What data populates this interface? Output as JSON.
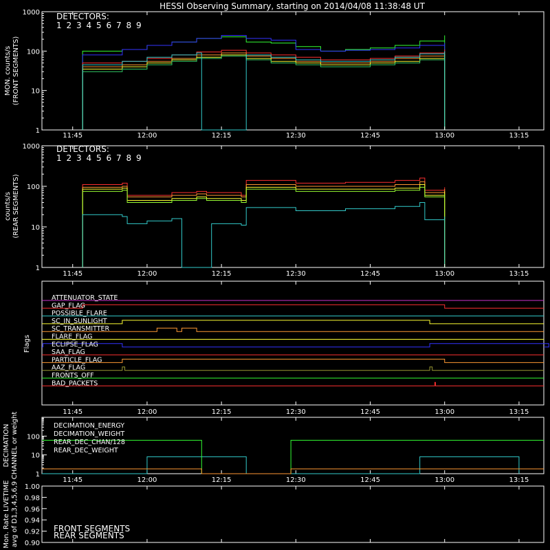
{
  "title": "HESSI Observing Summary, starting on 2014/04/08 11:38:48 UT",
  "x_ticks": [
    "11:45",
    "12:00",
    "12:15",
    "12:30",
    "12:45",
    "13:00",
    "13:15"
  ],
  "colors": {
    "d1": "#ff3030",
    "d2": "#ff3030",
    "d3": "#ff9933",
    "d4": "#ffff33",
    "d5": "#99ff33",
    "d6": "#33ff33",
    "d7": "#33cc66",
    "d8": "#33cccc",
    "d9": "#3333ff"
  },
  "chart_data": [
    {
      "type": "line",
      "ylabel": "MON. counts/s",
      "ylabel2": "(FRONT SEGMENTS)",
      "yscale": "log",
      "ylim": [
        1,
        1000
      ],
      "y_ticks": [
        "1",
        "10",
        "100",
        "1000"
      ],
      "legend_title": "DETECTORS:",
      "legend": [
        "1",
        "2",
        "3",
        "4",
        "5",
        "6",
        "7",
        "8",
        "9"
      ],
      "x_start": "11:38:48",
      "x_end": "13:20",
      "series": [
        {
          "name": "6",
          "color": "#33ff33",
          "x": [
            "11:47",
            "11:55",
            "12:00",
            "12:05",
            "12:10",
            "12:15",
            "12:20",
            "12:25",
            "12:30",
            "12:35",
            "12:40",
            "12:45",
            "12:50",
            "12:55",
            "13:00"
          ],
          "values": [
            100,
            110,
            140,
            170,
            210,
            230,
            170,
            160,
            130,
            100,
            110,
            120,
            140,
            180,
            250
          ]
        },
        {
          "name": "9",
          "color": "#3333ff",
          "x": [
            "11:47",
            "11:55",
            "12:00",
            "12:05",
            "12:10",
            "12:15",
            "12:20",
            "12:25",
            "12:30",
            "12:35",
            "12:40",
            "12:45",
            "12:50",
            "12:55",
            "13:00"
          ],
          "values": [
            80,
            110,
            140,
            170,
            210,
            250,
            210,
            190,
            110,
            100,
            105,
            110,
            120,
            140,
            160
          ]
        },
        {
          "name": "1",
          "color": "#ff3030",
          "x": [
            "11:47",
            "11:55",
            "12:00",
            "12:05",
            "12:10",
            "12:15",
            "12:20",
            "12:25",
            "12:30",
            "12:35",
            "12:40",
            "12:45",
            "12:50",
            "12:55",
            "13:00"
          ],
          "values": [
            50,
            55,
            65,
            80,
            95,
            105,
            90,
            80,
            70,
            60,
            60,
            65,
            75,
            90,
            110
          ]
        },
        {
          "name": "3",
          "color": "#ff9933",
          "x": [
            "11:47",
            "11:55",
            "12:00",
            "12:05",
            "12:10",
            "12:15",
            "12:20",
            "12:25",
            "12:30",
            "12:35",
            "12:40",
            "12:45",
            "12:50",
            "12:55",
            "13:00"
          ],
          "values": [
            40,
            45,
            55,
            65,
            80,
            90,
            75,
            65,
            55,
            50,
            50,
            55,
            65,
            75,
            95
          ]
        },
        {
          "name": "4",
          "color": "#ffff33",
          "x": [
            "11:47",
            "11:55",
            "12:00",
            "12:05",
            "12:10",
            "12:15",
            "12:20",
            "12:25",
            "12:30",
            "12:35",
            "12:40",
            "12:45",
            "12:50",
            "12:55",
            "13:00"
          ],
          "values": [
            35,
            40,
            50,
            60,
            70,
            80,
            65,
            55,
            50,
            45,
            45,
            50,
            55,
            65,
            85
          ]
        },
        {
          "name": "7",
          "color": "#33cc66",
          "x": [
            "11:47",
            "11:55",
            "12:00",
            "12:05",
            "12:10",
            "12:15",
            "12:20",
            "12:25",
            "12:30",
            "12:35",
            "12:40",
            "12:45",
            "12:50",
            "12:55",
            "13:00"
          ],
          "values": [
            30,
            35,
            45,
            55,
            65,
            75,
            60,
            50,
            45,
            40,
            40,
            45,
            50,
            60,
            75
          ]
        },
        {
          "name": "8",
          "color": "#33cccc",
          "x": [
            "11:47",
            "11:55",
            "12:00",
            "12:05",
            "12:10",
            "12:11",
            "12:16",
            "12:20",
            "12:25",
            "12:30",
            "12:35",
            "12:40",
            "12:45",
            "12:50",
            "12:55",
            "13:00"
          ],
          "values": [
            45,
            55,
            70,
            80,
            90,
            1,
            1,
            80,
            70,
            60,
            55,
            55,
            60,
            70,
            85,
            100
          ]
        }
      ]
    },
    {
      "type": "line",
      "ylabel": "counts/s",
      "ylabel2": "(REAR SEGMENTS)",
      "yscale": "log",
      "ylim": [
        1,
        1000
      ],
      "y_ticks": [
        "1",
        "10",
        "100",
        "1000"
      ],
      "legend_title": "DETECTORS:",
      "legend": [
        "1",
        "2",
        "3",
        "4",
        "5",
        "6",
        "7",
        "8",
        "9"
      ],
      "series": [
        {
          "name": "1",
          "color": "#ff3030",
          "x": [
            "11:47",
            "11:55",
            "11:56",
            "12:05",
            "12:10",
            "12:12",
            "12:19",
            "12:20",
            "12:30",
            "12:40",
            "12:50",
            "12:55",
            "12:56",
            "13:00"
          ],
          "values": [
            110,
            120,
            60,
            70,
            75,
            70,
            60,
            140,
            120,
            125,
            140,
            160,
            80,
            95
          ]
        },
        {
          "name": "3",
          "color": "#ff9933",
          "x": [
            "11:47",
            "11:55",
            "11:56",
            "12:05",
            "12:10",
            "12:12",
            "12:19",
            "12:20",
            "12:30",
            "12:40",
            "12:50",
            "12:55",
            "12:56",
            "13:00"
          ],
          "values": [
            95,
            100,
            55,
            60,
            65,
            60,
            55,
            110,
            100,
            100,
            110,
            130,
            70,
            85
          ]
        },
        {
          "name": "4",
          "color": "#ffff33",
          "x": [
            "11:47",
            "11:55",
            "11:56",
            "12:05",
            "12:10",
            "12:12",
            "12:19",
            "12:20",
            "12:30",
            "12:40",
            "12:50",
            "12:55",
            "12:56",
            "13:00"
          ],
          "values": [
            85,
            90,
            45,
            50,
            55,
            50,
            45,
            95,
            85,
            85,
            90,
            110,
            60,
            75
          ]
        },
        {
          "name": "5",
          "color": "#99ff33",
          "x": [
            "11:47",
            "11:55",
            "11:56",
            "12:05",
            "12:10",
            "12:12",
            "12:19",
            "12:20",
            "12:30",
            "12:40",
            "12:50",
            "12:55",
            "12:56",
            "13:00"
          ],
          "values": [
            75,
            80,
            40,
            45,
            50,
            45,
            40,
            85,
            75,
            75,
            80,
            95,
            55,
            65
          ]
        },
        {
          "name": "8",
          "color": "#33cccc",
          "x": [
            "11:47",
            "11:55",
            "11:56",
            "12:00",
            "12:05",
            "12:07",
            "12:13",
            "12:19",
            "12:20",
            "12:30",
            "12:40",
            "12:50",
            "12:55",
            "12:56",
            "13:00"
          ],
          "values": [
            20,
            18,
            12,
            14,
            16,
            1,
            12,
            11,
            30,
            25,
            28,
            32,
            40,
            15,
            18
          ]
        }
      ]
    },
    {
      "type": "flags",
      "ylabel": "Flags",
      "flags": [
        {
          "name": "ATTENUATOR_STATE",
          "color": "#cc33cc",
          "bumps": []
        },
        {
          "name": "GAP_FLAG",
          "color": "#ff3030",
          "bumps": [
            [
              "11:47",
              "13:00"
            ]
          ]
        },
        {
          "name": "POSSIBLE_FLARE",
          "color": "#33cccc",
          "bumps": []
        },
        {
          "name": "SC_IN_SUNLIGHT",
          "color": "#ffff33",
          "bumps": [
            [
              "11:55",
              "12:57"
            ]
          ]
        },
        {
          "name": "SC_TRANSMITTER",
          "color": "#ff9933",
          "bumps": [
            [
              "12:02",
              "12:06"
            ],
            [
              "12:07",
              "12:10"
            ]
          ]
        },
        {
          "name": "FLARE_FLAG",
          "color": "#ffff33",
          "bumps": []
        },
        {
          "name": "ECLIPSE_FLAG",
          "color": "#3333ff",
          "bumps": [
            [
              "11:39",
              "11:55"
            ],
            [
              "12:57",
              "13:21"
            ]
          ]
        },
        {
          "name": "SAA_FLAG",
          "color": "#ff3030",
          "bumps": []
        },
        {
          "name": "PARTICLE_FLAG",
          "color": "#ff9933",
          "bumps": [
            [
              "11:55",
              "13:00"
            ]
          ]
        },
        {
          "name": "AAZ_FLAG",
          "color": "#999933",
          "bumps": [
            [
              "11:55",
              "11:55:30"
            ],
            [
              "12:57",
              "12:57:30"
            ]
          ]
        },
        {
          "name": "FRONTS_OFF",
          "color": "#33ff33",
          "bumps": []
        },
        {
          "name": "BAD_PACKETS",
          "color": "#ff3030",
          "bumps": [
            [
              "12:58",
              "12:58:10"
            ]
          ]
        }
      ]
    },
    {
      "type": "line",
      "ylabel": "DECIMATION",
      "ylabel2": "CHANNEL or weight",
      "yscale": "log",
      "ylim": [
        1,
        1000
      ],
      "y_ticks": [
        "1",
        "10",
        "100"
      ],
      "legend": [
        "DECIMATION_ENERGY",
        "DECIMATION_WEIGHT",
        "REAR_DEC_CHAN/128",
        "REAR_DEC_WEIGHT"
      ]
    },
    {
      "type": "line",
      "ylabel": "Mon. Rate LIVETIME",
      "ylabel2": "avg of D1,3,4,5,6,9",
      "ylim": [
        0.9,
        1.0
      ],
      "y_ticks": [
        "0.90",
        "0.92",
        "0.94",
        "0.96",
        "0.98",
        "1.00"
      ],
      "legend": [
        "FRONT SEGMENTS",
        "REAR SEGMENTS"
      ]
    }
  ]
}
